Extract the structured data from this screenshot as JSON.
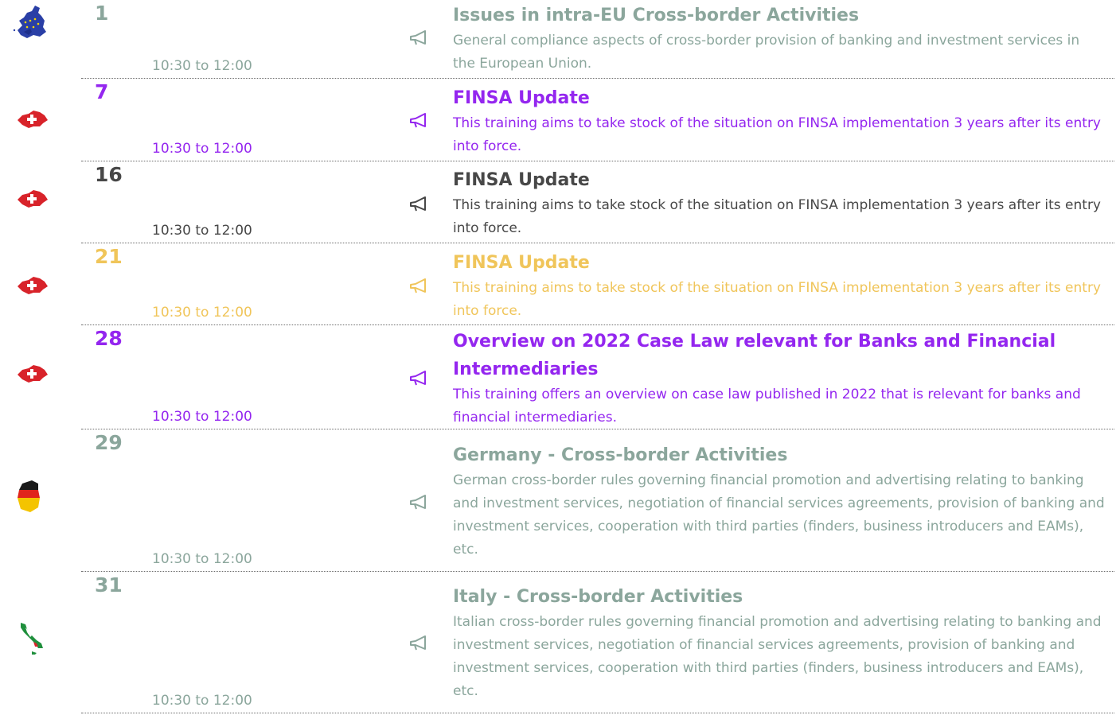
{
  "colors": {
    "grey": "#8ba69c",
    "purple": "#9426ef",
    "dark": "#474747",
    "yellow": "#f0c55a"
  },
  "events": [
    {
      "day": "1",
      "time": "10:30 to 12:00",
      "title": "Issues in intra-EU Cross-border Activities",
      "description": "General compliance aspects of cross-border provision of banking and investment services in the European Union.",
      "region_icon": "eu-map-icon",
      "color": "grey"
    },
    {
      "day": "7",
      "time": "10:30 to 12:00",
      "title": "FINSA Update",
      "description": "This training aims to take stock of the situation on FINSA implementation 3 years after its entry into force.",
      "region_icon": "switzerland-map-icon",
      "color": "purple"
    },
    {
      "day": "16",
      "time": "10:30 to 12:00",
      "title": "FINSA Update",
      "description": "This training aims to take stock of the situation on FINSA implementation 3 years after its entry into force.",
      "region_icon": "switzerland-map-icon",
      "color": "dark"
    },
    {
      "day": "21",
      "time": "10:30 to 12:00",
      "title": "FINSA Update",
      "description": "This training aims to take stock of the situation on FINSA implementation 3 years after its entry into force.",
      "region_icon": "switzerland-map-icon",
      "color": "yellow"
    },
    {
      "day": "28",
      "time": "10:30 to 12:00",
      "title": "Overview on 2022 Case Law relevant for Banks and Financial Intermediaries",
      "description": "This training offers an overview on case law published in 2022 that is relevant for banks and financial intermediaries.",
      "region_icon": "switzerland-map-icon",
      "color": "purple"
    },
    {
      "day": "29",
      "time": "10:30 to 12:00",
      "title": "Germany - Cross-border Activities",
      "description": "German cross-border rules governing financial promotion and advertising relating to banking and investment services, negotiation of financial services agreements, provision of banking and investment services, cooperation with third parties (finders, business introducers and EAMs), etc.",
      "region_icon": "germany-map-icon",
      "color": "grey"
    },
    {
      "day": "31",
      "time": "10:30 to 12:00",
      "title": "Italy - Cross-border Activities",
      "description": "Italian cross-border rules governing financial promotion and advertising relating to banking and investment services, negotiation of financial services agreements, provision of banking and investment services, cooperation with third parties (finders, business introducers and EAMs), etc.",
      "region_icon": "italy-map-icon",
      "color": "grey"
    }
  ]
}
